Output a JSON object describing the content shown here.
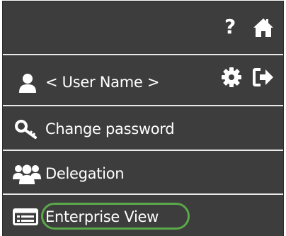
{
  "header": {
    "help_glyph": "?",
    "icons": [
      "help-icon",
      "home-icon"
    ]
  },
  "user": {
    "name": "< User Name >",
    "icons": [
      "user-icon",
      "settings-gear-icon",
      "logout-icon"
    ]
  },
  "menu": {
    "items": [
      {
        "label": "Change password",
        "icon": "key-icon"
      },
      {
        "label": "Delegation",
        "icon": "group-icon"
      },
      {
        "label": "Enterprise View",
        "icon": "list-window-icon"
      }
    ]
  },
  "colors": {
    "panel_bg": "#3d3d3d",
    "divider": "#e9e9e9",
    "text": "#ffffff",
    "highlight": "#5aa84a"
  }
}
